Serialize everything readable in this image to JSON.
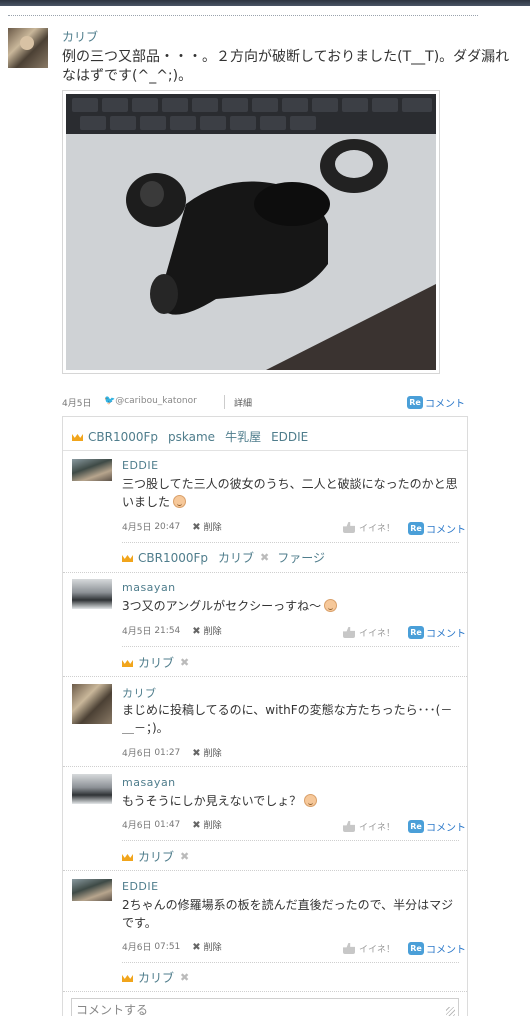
{
  "post": {
    "author": "カリブ",
    "text": "例の三つ又部品・・・。２方向が破断しておりました(T__T)。ダダ漏れなはずです(^_^;)。",
    "date": "4月5日",
    "twitter": "@caribou_katonor",
    "detail_link": "詳細",
    "re_badge": "Re",
    "comment_label": "コメント"
  },
  "likers_top": [
    "CBR1000Fp",
    "pskame",
    "牛乳屋",
    "EDDIE"
  ],
  "comments": [
    {
      "name": "EDDIE",
      "text": "三つ股してた三人の彼女のうち、二人と破談になったのかと思いました",
      "date": "4月5日",
      "time": "20:47",
      "delete": "削除",
      "like": "イイネ！",
      "likers": [
        "CBR1000Fp",
        "カリブ",
        "ファージ"
      ]
    },
    {
      "name": "masayan",
      "text": "3つ又のアングルがセクシーっすね～",
      "date": "4月5日",
      "time": "21:54",
      "delete": "削除",
      "like": "イイネ！",
      "likers": [
        "カリブ"
      ]
    },
    {
      "name": "カリブ",
      "text": "まじめに投稿してるのに、withFの変態な方たちったら･･･(－＿－；)。",
      "date": "4月6日",
      "time": "01:27",
      "delete": "削除"
    },
    {
      "name": "masayan",
      "text": "もうそうにしか見えないでしょ？",
      "date": "4月6日",
      "time": "01:47",
      "delete": "削除",
      "like": "イイネ！",
      "likers": [
        "カリブ"
      ]
    },
    {
      "name": "EDDIE",
      "text": "2ちゃんの修羅場系の板を読んだ直後だったので、半分はマジです。",
      "date": "4月6日",
      "time": "07:51",
      "delete": "削除",
      "like": "イイネ！",
      "likers": [
        "カリブ"
      ]
    }
  ],
  "comment_input": {
    "placeholder": "コメントする"
  },
  "colors": {
    "link": "#4f7d8c",
    "re_badge": "#4a9fd8",
    "crown": "#f1a51c"
  },
  "icons": [
    "twitter-bird-icon",
    "crown-icon",
    "delete-x-icon",
    "thumbs-up-icon",
    "smile-emoji-icon",
    "resize-grip-icon"
  ]
}
